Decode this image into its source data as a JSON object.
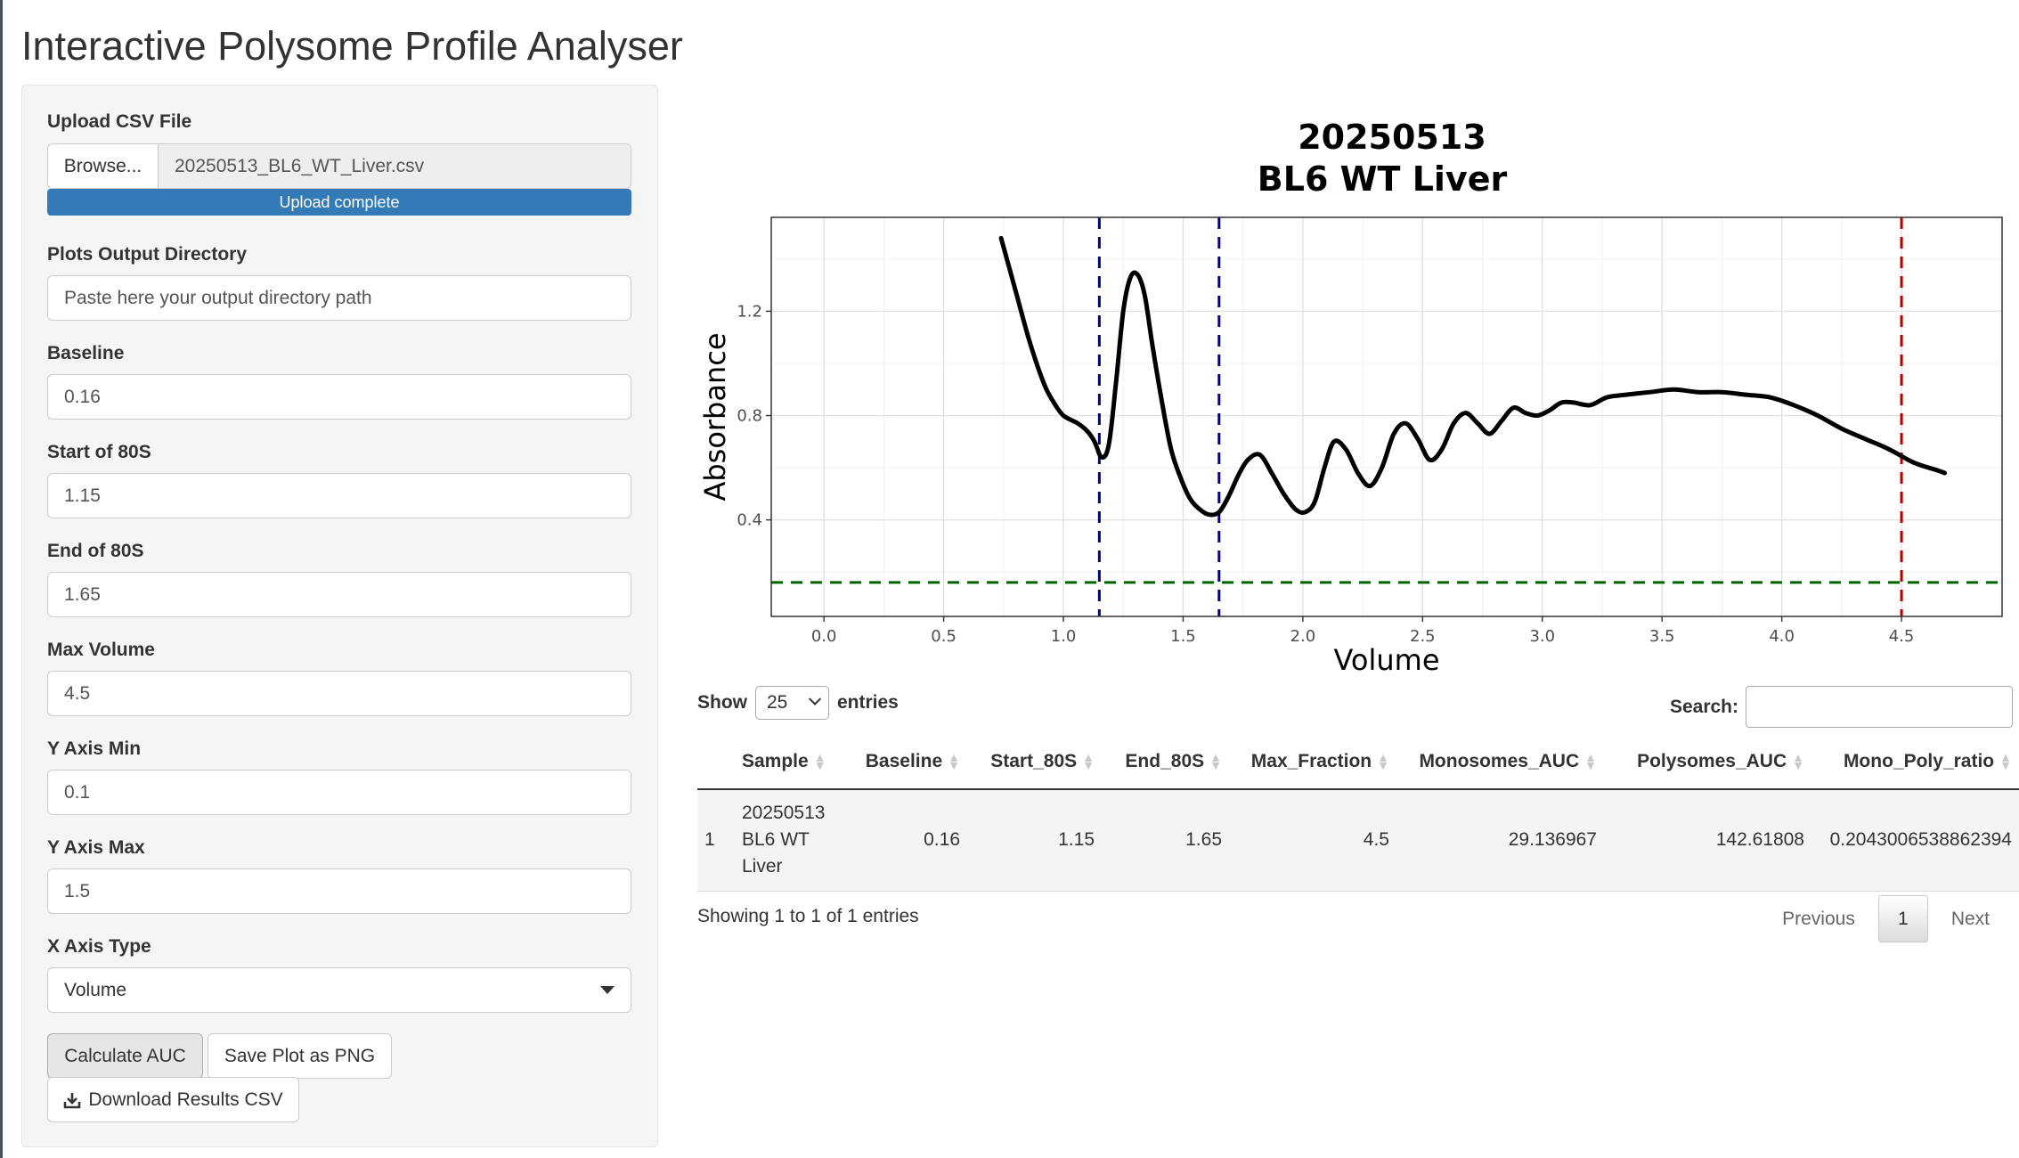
{
  "app": {
    "title": "Interactive Polysome Profile Analyser"
  },
  "sidebar": {
    "upload": {
      "label": "Upload CSV File",
      "browse_label": "Browse...",
      "file_name": "20250513_BL6_WT_Liver.csv",
      "progress_text": "Upload complete",
      "progress": 1.0
    },
    "output_dir": {
      "label": "Plots Output Directory",
      "placeholder": "Paste here your output directory path"
    },
    "baseline": {
      "label": "Baseline",
      "value": "0.16"
    },
    "start_80s": {
      "label": "Start of 80S",
      "value": "1.15"
    },
    "end_80s": {
      "label": "End of 80S",
      "value": "1.65"
    },
    "max_volume": {
      "label": "Max Volume",
      "value": "4.5"
    },
    "y_min": {
      "label": "Y Axis Min",
      "value": "0.1"
    },
    "y_max": {
      "label": "Y Axis Max",
      "value": "1.5"
    },
    "x_axis_type": {
      "label": "X Axis Type",
      "value": "Volume"
    },
    "buttons": {
      "calculate": "Calculate AUC",
      "save_png": "Save Plot as PNG",
      "download": "Download Results CSV"
    }
  },
  "chart_data": {
    "type": "line",
    "title": "20250513",
    "subtitle": "BL6 WT Liver",
    "xlabel": "Volume",
    "ylabel": "Absorbance",
    "xlim": [
      -0.22,
      4.92
    ],
    "ylim": [
      0.03,
      1.56
    ],
    "x_ticks": [
      "0.0",
      "0.5",
      "1.0",
      "1.5",
      "2.0",
      "2.5",
      "3.0",
      "3.5",
      "4.0",
      "4.5"
    ],
    "y_ticks": [
      "0.4",
      "0.8",
      "1.2"
    ],
    "grid": true,
    "series": [
      {
        "color": "#000000",
        "x": [
          0.74,
          0.8,
          0.86,
          0.92,
          0.96,
          1.0,
          1.06,
          1.1,
          1.13,
          1.16,
          1.19,
          1.22,
          1.25,
          1.28,
          1.31,
          1.34,
          1.37,
          1.41,
          1.45,
          1.49,
          1.53,
          1.57,
          1.61,
          1.65,
          1.69,
          1.73,
          1.77,
          1.82,
          1.87,
          1.92,
          1.97,
          2.01,
          2.05,
          2.09,
          2.13,
          2.18,
          2.23,
          2.28,
          2.33,
          2.38,
          2.43,
          2.48,
          2.53,
          2.58,
          2.63,
          2.68,
          2.73,
          2.78,
          2.83,
          2.88,
          2.93,
          2.98,
          3.03,
          3.08,
          3.13,
          3.2,
          3.27,
          3.35,
          3.45,
          3.55,
          3.65,
          3.75,
          3.85,
          3.95,
          4.05,
          4.15,
          4.25,
          4.35,
          4.45,
          4.55,
          4.65,
          4.68
        ],
        "y": [
          1.48,
          1.28,
          1.08,
          0.92,
          0.85,
          0.8,
          0.77,
          0.74,
          0.7,
          0.64,
          0.69,
          0.93,
          1.2,
          1.33,
          1.34,
          1.26,
          1.08,
          0.86,
          0.67,
          0.56,
          0.48,
          0.44,
          0.42,
          0.43,
          0.49,
          0.57,
          0.63,
          0.65,
          0.58,
          0.5,
          0.44,
          0.43,
          0.47,
          0.6,
          0.7,
          0.67,
          0.58,
          0.53,
          0.6,
          0.73,
          0.77,
          0.71,
          0.63,
          0.67,
          0.77,
          0.81,
          0.77,
          0.73,
          0.78,
          0.83,
          0.81,
          0.8,
          0.82,
          0.85,
          0.85,
          0.84,
          0.87,
          0.88,
          0.89,
          0.9,
          0.89,
          0.89,
          0.88,
          0.87,
          0.84,
          0.8,
          0.75,
          0.71,
          0.67,
          0.62,
          0.59,
          0.58
        ]
      }
    ],
    "reference_lines": [
      {
        "axis": "x",
        "value": 1.15,
        "color": "#00008b"
      },
      {
        "axis": "x",
        "value": 1.65,
        "color": "#00008b"
      },
      {
        "axis": "x",
        "value": 4.5,
        "color": "#b00000"
      },
      {
        "axis": "y",
        "value": 0.16,
        "color": "#006400"
      }
    ]
  },
  "table": {
    "show_label": "Show",
    "entries_value": "25",
    "entries_label": "entries",
    "search_label": "Search:",
    "columns": [
      "",
      "Sample",
      "Baseline",
      "Start_80S",
      "End_80S",
      "Max_Fraction",
      "Monosomes_AUC",
      "Polysomes_AUC",
      "Mono_Poly_ratio"
    ],
    "rows": [
      {
        "index": "1",
        "sample_line1": "20250513",
        "sample_line2": "BL6 WT",
        "sample_line3": "Liver",
        "baseline": "0.16",
        "start_80s": "1.15",
        "end_80s": "1.65",
        "max_fraction": "4.5",
        "monosomes_auc": "29.136967",
        "polysomes_auc": "142.61808",
        "ratio": "0.2043006538862394"
      }
    ],
    "info": "Showing 1 to 1 of 1 entries",
    "pager": {
      "previous": "Previous",
      "current": "1",
      "next": "Next"
    }
  }
}
